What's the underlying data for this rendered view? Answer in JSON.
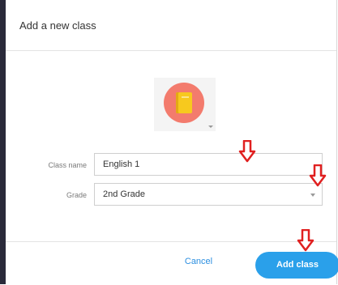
{
  "dialog": {
    "title": "Add a new class"
  },
  "class_icon": {
    "icon": "notebook-icon",
    "circle_color": "#f37b6d",
    "book_color": "#f7c91e"
  },
  "form": {
    "class_name": {
      "label": "Class name",
      "value": "English 1"
    },
    "grade": {
      "label": "Grade",
      "value": "2nd Grade"
    }
  },
  "footer": {
    "cancel_label": "Cancel",
    "add_label": "Add class",
    "accent_color": "#2aa0ea"
  },
  "annotations": {
    "arrow_color": "#e02020",
    "arrow_icon": "down-arrow-icon"
  }
}
